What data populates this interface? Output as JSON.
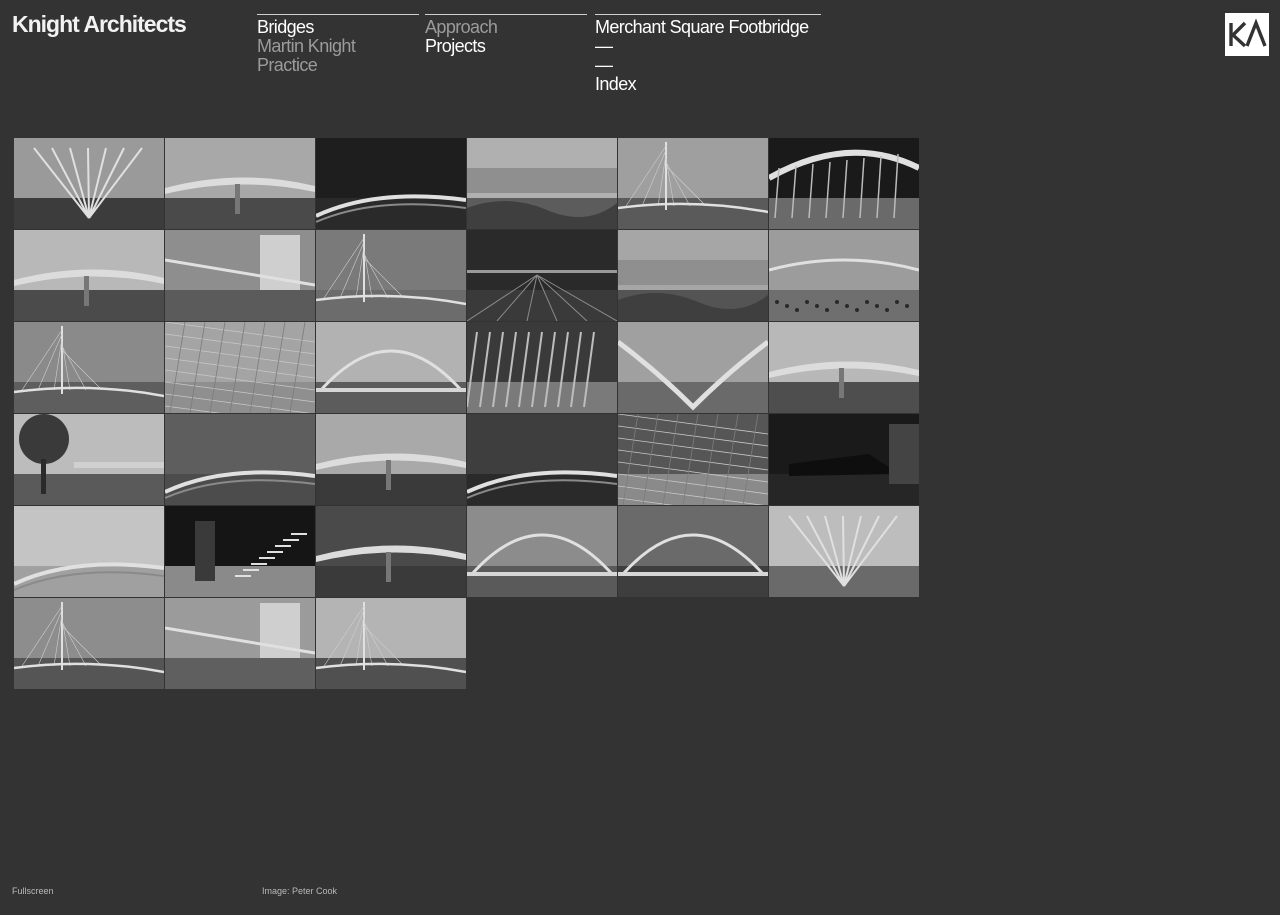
{
  "brand": {
    "title": "Knight Architects"
  },
  "logo": {
    "text": "KA"
  },
  "nav": {
    "col1": [
      {
        "label": "Bridges",
        "state": "active"
      },
      {
        "label": "Martin Knight",
        "state": "dim"
      },
      {
        "label": "Practice",
        "state": "dim"
      }
    ],
    "col2": [
      {
        "label": "Approach",
        "state": "dim"
      },
      {
        "label": "Projects",
        "state": "active"
      }
    ],
    "col3": [
      {
        "label": "Merchant Square Footbridge",
        "state": "active"
      },
      {
        "label": "—",
        "state": "dash"
      },
      {
        "label": "—",
        "state": "dash"
      },
      {
        "label": "Index",
        "state": "active"
      }
    ]
  },
  "thumbnails": [
    {
      "sky": "#9a9a9a",
      "ground": "#3c3c3c",
      "kind": "fan"
    },
    {
      "sky": "#a8a8a8",
      "ground": "#4a4a4a",
      "kind": "deck"
    },
    {
      "sky": "#1e1e1e",
      "ground": "#2a2a2a",
      "kind": "curve"
    },
    {
      "sky": "#b0b0b0",
      "ground": "#5c5c5c",
      "kind": "aerial"
    },
    {
      "sky": "#9f9f9f",
      "ground": "#5a5a5a",
      "kind": "pylon"
    },
    {
      "sky": "#1a1a1a",
      "ground": "#6a6a6a",
      "kind": "arch-side"
    },
    {
      "sky": "#b8b8b8",
      "ground": "#4b4b4b",
      "kind": "deck"
    },
    {
      "sky": "#8e8e8e",
      "ground": "#5b5b5b",
      "kind": "street"
    },
    {
      "sky": "#7a7a7a",
      "ground": "#6c6c6c",
      "kind": "pylon"
    },
    {
      "sky": "#2a2a2a",
      "ground": "#3a3a3a",
      "kind": "rails"
    },
    {
      "sky": "#a6a6a6",
      "ground": "#545454",
      "kind": "aerial"
    },
    {
      "sky": "#9c9c9c",
      "ground": "#6f6f6f",
      "kind": "crowd"
    },
    {
      "sky": "#8a8a8a",
      "ground": "#5e5e5e",
      "kind": "pylon"
    },
    {
      "sky": "#a4a4a4",
      "ground": "#8f8f8f",
      "kind": "map"
    },
    {
      "sky": "#b2b2b2",
      "ground": "#5c5c5c",
      "kind": "arch"
    },
    {
      "sky": "#3a3a3a",
      "ground": "#7a7a7a",
      "kind": "ribs"
    },
    {
      "sky": "#a0a0a0",
      "ground": "#6a6a6a",
      "kind": "tunnel"
    },
    {
      "sky": "#b8b8b8",
      "ground": "#4e4e4e",
      "kind": "deck"
    },
    {
      "sky": "#bcbcbc",
      "ground": "#5a5a5a",
      "kind": "tree"
    },
    {
      "sky": "#5e5e5e",
      "ground": "#4c4c4c",
      "kind": "curve"
    },
    {
      "sky": "#a9a9a9",
      "ground": "#3a3a3a",
      "kind": "deck"
    },
    {
      "sky": "#3e3e3e",
      "ground": "#2a2a2a",
      "kind": "curve"
    },
    {
      "sky": "#565656",
      "ground": "#8a8a8a",
      "kind": "map"
    },
    {
      "sky": "#1a1a1a",
      "ground": "#262626",
      "kind": "night"
    },
    {
      "sky": "#c4c4c4",
      "ground": "#a0a0a0",
      "kind": "curve"
    },
    {
      "sky": "#151515",
      "ground": "#8a8a8a",
      "kind": "stairs"
    },
    {
      "sky": "#4a4a4a",
      "ground": "#3a3a3a",
      "kind": "deck"
    },
    {
      "sky": "#8c8c8c",
      "ground": "#5a5a5a",
      "kind": "arch"
    },
    {
      "sky": "#6a6a6a",
      "ground": "#3e3e3e",
      "kind": "arch"
    },
    {
      "sky": "#bdbdbd",
      "ground": "#6a6a6a",
      "kind": "fan"
    },
    {
      "sky": "#8d8d8d",
      "ground": "#555555",
      "kind": "pylon"
    },
    {
      "sky": "#9b9b9b",
      "ground": "#5f5f5f",
      "kind": "street"
    },
    {
      "sky": "#b4b4b4",
      "ground": "#505050",
      "kind": "pylon"
    }
  ],
  "footer": {
    "fullscreen": "Fullscreen",
    "credit": "Image: Peter Cook"
  }
}
